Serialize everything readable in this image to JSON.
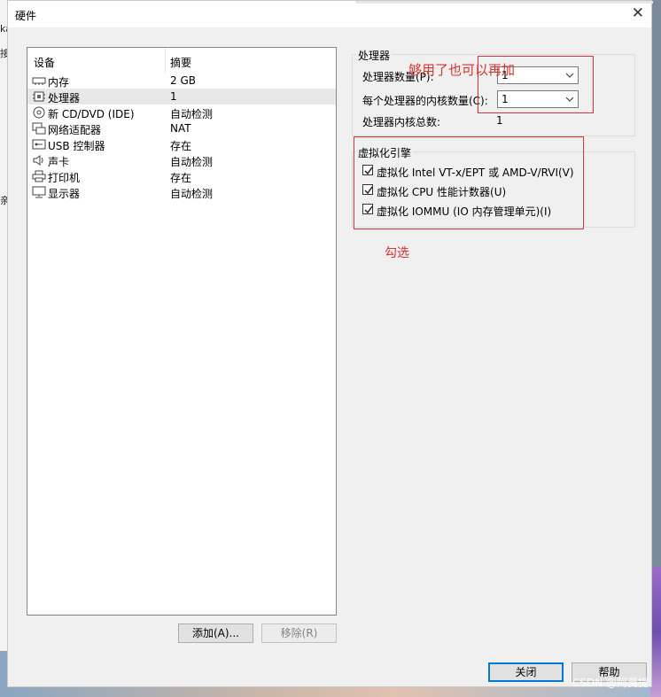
{
  "window": {
    "title": "硬件",
    "close_glyph": "✕"
  },
  "devices": {
    "col_device": "设备",
    "col_summary": "摘要",
    "items": [
      {
        "icon": "memory-icon",
        "name": "内存",
        "summary": "2 GB"
      },
      {
        "icon": "cpu-icon",
        "name": "处理器",
        "summary": "1",
        "selected": true
      },
      {
        "icon": "cd-icon",
        "name": "新 CD/DVD (IDE)",
        "summary": "自动检测"
      },
      {
        "icon": "network-icon",
        "name": "网络适配器",
        "summary": "NAT"
      },
      {
        "icon": "usb-icon",
        "name": "USB 控制器",
        "summary": "存在"
      },
      {
        "icon": "sound-icon",
        "name": "声卡",
        "summary": "自动检测"
      },
      {
        "icon": "printer-icon",
        "name": "打印机",
        "summary": "存在"
      },
      {
        "icon": "display-icon",
        "name": "显示器",
        "summary": "自动检测"
      }
    ],
    "add_button": "添加(A)...",
    "remove_button": "移除(R)"
  },
  "processor": {
    "group_title": "处理器",
    "count_label": "处理器数量(P):",
    "count_value": "1",
    "cores_label": "每个处理器的内核数量(C):",
    "cores_value": "1",
    "total_label": "处理器内核总数:",
    "total_value": "1"
  },
  "virtualization": {
    "group_title": "虚拟化引擎",
    "options": [
      {
        "label": "虚拟化 Intel VT-x/EPT 或 AMD-V/RVI(V)",
        "checked": true
      },
      {
        "label": "虚拟化 CPU 性能计数器(U)",
        "checked": true
      },
      {
        "label": "虚拟化 IOMMU (IO 内存管理单元)(I)",
        "checked": true
      }
    ]
  },
  "annotations": {
    "more_note": "够用了也可以再加",
    "check_note": "勾选",
    "color": "#e03030"
  },
  "footer": {
    "close_button": "关闭",
    "help_button": "帮助"
  },
  "background": {
    "left_fragment_1": "ka",
    "left_fragment_2": "接",
    "left_fragment_3": "亲"
  },
  "watermark": "CSDN @阿莫提"
}
